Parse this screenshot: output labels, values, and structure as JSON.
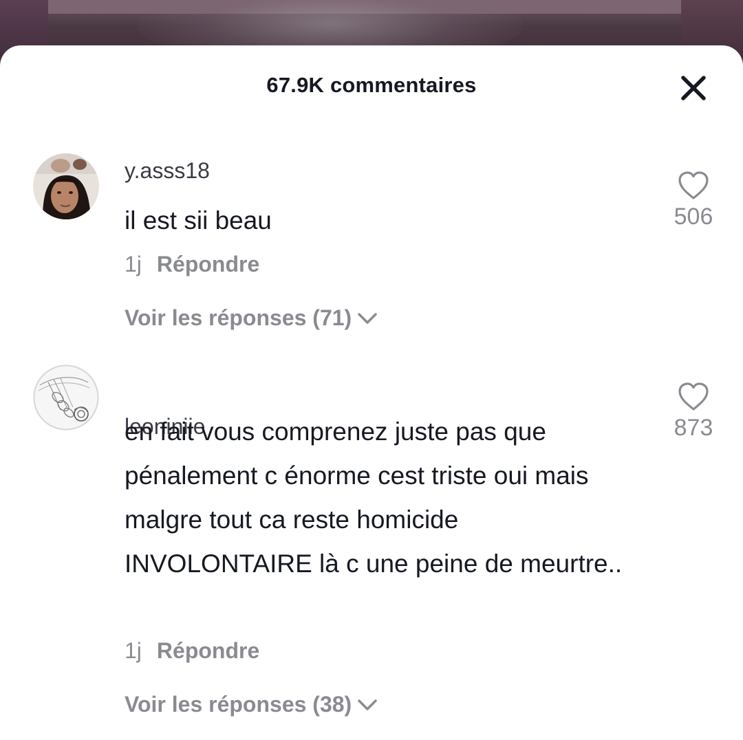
{
  "header": {
    "title": "67.9K commentaires",
    "close_icon": "close-icon"
  },
  "comments": [
    {
      "username": "y.asss18",
      "text": "il est sii beau",
      "time": "1j",
      "reply_label": "Répondre",
      "likes": "506",
      "view_replies": "Voir les réponses (71)",
      "avatar_icon": "user-avatar-photo"
    },
    {
      "username": "leoniniie",
      "text": "en fait vous comprenez juste pas que pénalement c énorme cest triste oui mais malgre tout ca reste homicide INVOLONTAIRE là c une peine de meurtre..",
      "time": "1j",
      "reply_label": "Répondre",
      "likes": "873",
      "view_replies": "Voir les réponses (38)",
      "avatar_icon": "braid-sketch-avatar"
    }
  ],
  "colors": {
    "primary_text": "#161823",
    "secondary_text": "#8a8b91",
    "sheet_background": "#ffffff"
  }
}
